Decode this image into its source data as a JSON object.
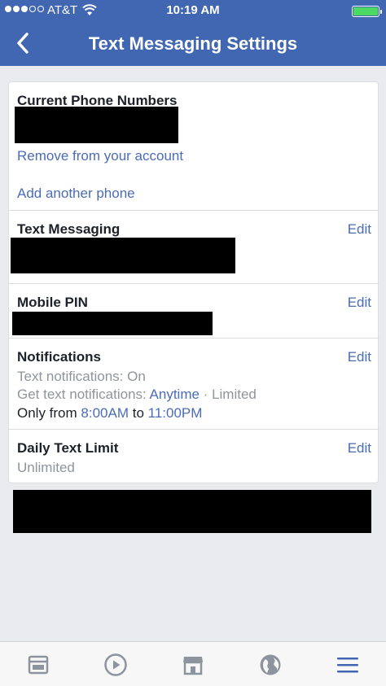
{
  "status_bar": {
    "carrier": "AT&T",
    "time": "10:19 AM"
  },
  "header": {
    "title": "Text Messaging Settings",
    "back_icon": "chevron-left-icon"
  },
  "sections": {
    "phone_numbers": {
      "heading": "Current Phone Numbers",
      "remove_link": "Remove from your account",
      "add_link": "Add another phone"
    },
    "text_messaging": {
      "heading": "Text Messaging",
      "edit": "Edit"
    },
    "mobile_pin": {
      "heading": "Mobile PIN",
      "edit": "Edit"
    },
    "notifications": {
      "heading": "Notifications",
      "edit": "Edit",
      "status_line": "Text notifications: On",
      "get_prefix": "Get text notifications: ",
      "get_value": "Anytime",
      "get_sep": " · ",
      "get_limited": "Limited",
      "only_prefix": "Only from ",
      "from_time": "8:00AM",
      "to_word": " to ",
      "to_time": "11:00PM"
    },
    "daily_limit": {
      "heading": "Daily Text Limit",
      "edit": "Edit",
      "value": "Unlimited"
    }
  },
  "tab_bar": {
    "tabs": [
      "news-feed-icon",
      "video-play-icon",
      "marketplace-icon",
      "globe-notifications-icon",
      "menu-icon"
    ],
    "active": "menu-icon"
  },
  "colors": {
    "header_bg": "#4267b2",
    "link": "#4b6cb7",
    "muted": "#90949c",
    "battery": "#4cd964",
    "tab_active": "#4267b2",
    "tab_inactive": "#8d949e"
  }
}
